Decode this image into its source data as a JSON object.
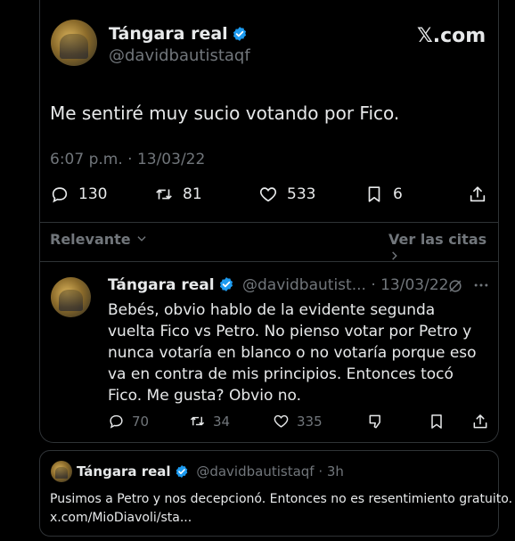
{
  "main_tweet": {
    "author_name": "Tángara real",
    "handle": "@davidbautistaqf",
    "brand": "𝕏.com",
    "text": "Me sentiré muy sucio votando por Fico.",
    "timestamp": "6:07 p.m. · 13/03/22",
    "replies": "130",
    "retweets": "81",
    "likes": "533",
    "bookmarks": "6"
  },
  "filter_bar": {
    "sort_label": "Relevante",
    "quotes_link": "Ver las citas"
  },
  "reply": {
    "author_name": "Tángara real",
    "handle": "@davidbautist...",
    "date": "· 13/03/22",
    "text": "Bebés, obvio hablo de la evidente segunda vuelta Fico vs Petro. No pienso votar por Petro y nunca votaría en blanco o no votaría porque eso va en contra de mis principios. Entonces tocó Fico. Me gusta? Obvio no.",
    "replies": "70",
    "retweets": "34",
    "likes": "335"
  },
  "quote_tweet": {
    "author_name": "Tángara real",
    "handle": "@davidbautistaqf · 3h",
    "text": "Pusimos a Petro y nos decepcionó. Entonces no es resentimiento gratuito.",
    "link": "x.com/MioDiavoli/sta..."
  },
  "colors": {
    "background": "#000000",
    "text": "#e7e9ea",
    "muted": "#71767b",
    "verified": "#1d9bf0",
    "border": "#2f3336"
  }
}
